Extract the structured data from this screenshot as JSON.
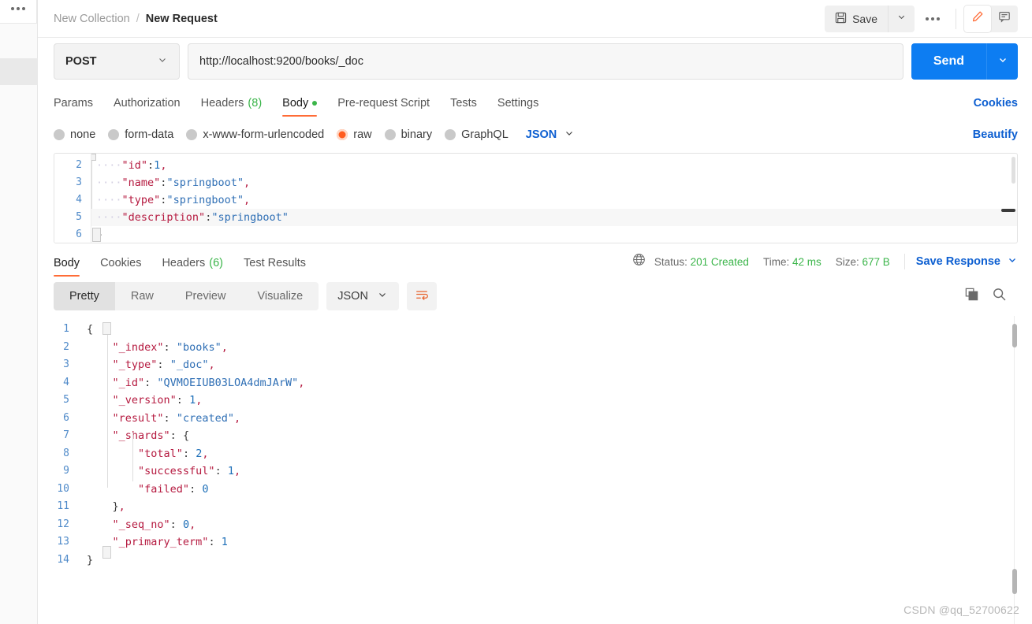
{
  "window": {
    "watermark": "CSDN @qq_52700622"
  },
  "sidebar": {
    "more_menu": "sidebar-options"
  },
  "header": {
    "breadcrumb": {
      "collection": "New Collection",
      "separator": "/",
      "request": "New Request"
    },
    "save_label": "Save",
    "save_icon": "floppy-disk-icon",
    "save_caret_icon": "chevron-down-icon",
    "more_icon": "ellipsis-icon",
    "edit_icon": "pencil-icon",
    "comment_icon": "comment-icon"
  },
  "request": {
    "method": "POST",
    "method_caret_icon": "chevron-down-icon",
    "url": "http://localhost:9200/books/_doc",
    "send_label": "Send",
    "send_caret_icon": "chevron-down-icon",
    "tabs": [
      {
        "label": "Params",
        "badge": "",
        "active": false
      },
      {
        "label": "Authorization",
        "badge": "",
        "active": false
      },
      {
        "label": "Headers",
        "badge": "(8)",
        "active": false
      },
      {
        "label": "Body",
        "badge": "",
        "active": true,
        "dot": true
      },
      {
        "label": "Pre-request Script",
        "badge": "",
        "active": false
      },
      {
        "label": "Tests",
        "badge": "",
        "active": false
      },
      {
        "label": "Settings",
        "badge": "",
        "active": false
      }
    ],
    "cookies_link": "Cookies",
    "beautify_link": "Beautify",
    "body_types": [
      {
        "label": "none",
        "selected": false
      },
      {
        "label": "form-data",
        "selected": false
      },
      {
        "label": "x-www-form-urlencoded",
        "selected": false
      },
      {
        "label": "raw",
        "selected": true
      },
      {
        "label": "binary",
        "selected": false
      },
      {
        "label": "GraphQL",
        "selected": false
      }
    ],
    "raw_format": "JSON",
    "raw_format_caret_icon": "chevron-down-icon",
    "body_lines": [
      {
        "no": "2",
        "indent": "····",
        "key": "\"id\"",
        "colon": ":",
        "value": "1",
        "value_type": "number",
        "tail": ","
      },
      {
        "no": "3",
        "indent": "····",
        "key": "\"name\"",
        "colon": ":",
        "value": "\"springboot\"",
        "value_type": "string",
        "tail": ","
      },
      {
        "no": "4",
        "indent": "····",
        "key": "\"type\"",
        "colon": ":",
        "value": "\"springboot\"",
        "value_type": "string",
        "tail": ","
      },
      {
        "no": "5",
        "indent": "····",
        "key": "\"description\"",
        "colon": ":",
        "value": "\"springboot\"",
        "value_type": "string",
        "tail": ""
      },
      {
        "no": "6",
        "indent": "",
        "key": "",
        "colon": "",
        "value": "}",
        "value_type": "punct",
        "tail": ""
      }
    ]
  },
  "response": {
    "tabs": [
      {
        "label": "Body",
        "badge": "",
        "active": true
      },
      {
        "label": "Cookies",
        "badge": "",
        "active": false
      },
      {
        "label": "Headers",
        "badge": "(6)",
        "active": false
      },
      {
        "label": "Test Results",
        "badge": "",
        "active": false
      }
    ],
    "globe_icon": "globe-icon",
    "status_label": "Status:",
    "status_value": "201 Created",
    "time_label": "Time:",
    "time_value": "42 ms",
    "size_label": "Size:",
    "size_value": "677 B",
    "save_response_label": "Save Response",
    "save_response_caret_icon": "chevron-down-icon",
    "view_modes": [
      {
        "label": "Pretty",
        "active": true
      },
      {
        "label": "Raw",
        "active": false
      },
      {
        "label": "Preview",
        "active": false
      },
      {
        "label": "Visualize",
        "active": false
      }
    ],
    "format": "JSON",
    "format_caret_icon": "chevron-down-icon",
    "wrap_icon": "wrap-text-icon",
    "copy_icon": "copy-icon",
    "search_icon": "search-icon",
    "body_lines": [
      {
        "no": "1",
        "indent": "",
        "key": "",
        "colon": "",
        "value": "{",
        "value_type": "punct",
        "tail": ""
      },
      {
        "no": "2",
        "indent": "    ",
        "key": "\"_index\"",
        "colon": ": ",
        "value": "\"books\"",
        "value_type": "string",
        "tail": ","
      },
      {
        "no": "3",
        "indent": "    ",
        "key": "\"_type\"",
        "colon": ": ",
        "value": "\"_doc\"",
        "value_type": "string",
        "tail": ","
      },
      {
        "no": "4",
        "indent": "    ",
        "key": "\"_id\"",
        "colon": ": ",
        "value": "\"QVMOEIUB03LOA4dmJArW\"",
        "value_type": "string",
        "tail": ","
      },
      {
        "no": "5",
        "indent": "    ",
        "key": "\"_version\"",
        "colon": ": ",
        "value": "1",
        "value_type": "number",
        "tail": ","
      },
      {
        "no": "6",
        "indent": "    ",
        "key": "\"result\"",
        "colon": ": ",
        "value": "\"created\"",
        "value_type": "string",
        "tail": ","
      },
      {
        "no": "7",
        "indent": "    ",
        "key": "\"_shards\"",
        "colon": ": ",
        "value": "{",
        "value_type": "punct",
        "tail": ""
      },
      {
        "no": "8",
        "indent": "        ",
        "key": "\"total\"",
        "colon": ": ",
        "value": "2",
        "value_type": "number",
        "tail": ","
      },
      {
        "no": "9",
        "indent": "        ",
        "key": "\"successful\"",
        "colon": ": ",
        "value": "1",
        "value_type": "number",
        "tail": ","
      },
      {
        "no": "10",
        "indent": "        ",
        "key": "\"failed\"",
        "colon": ": ",
        "value": "0",
        "value_type": "number",
        "tail": ""
      },
      {
        "no": "11",
        "indent": "    ",
        "key": "",
        "colon": "",
        "value": "}",
        "value_type": "punct",
        "tail": ","
      },
      {
        "no": "12",
        "indent": "    ",
        "key": "\"_seq_no\"",
        "colon": ": ",
        "value": "0",
        "value_type": "number",
        "tail": ","
      },
      {
        "no": "13",
        "indent": "    ",
        "key": "\"_primary_term\"",
        "colon": ": ",
        "value": "1",
        "value_type": "number",
        "tail": ""
      },
      {
        "no": "14",
        "indent": "",
        "key": "",
        "colon": "",
        "value": "}",
        "value_type": "punct",
        "tail": ""
      }
    ]
  },
  "colors": {
    "accent_orange": "#ff6c37",
    "accent_blue": "#0d7df2",
    "link_blue": "#0d5fd1",
    "success_green": "#3bb54a",
    "json_key": "#b5193f",
    "json_string": "#2f6fb5",
    "json_number": "#1d6fb8",
    "line_number": "#4f8ac9"
  }
}
